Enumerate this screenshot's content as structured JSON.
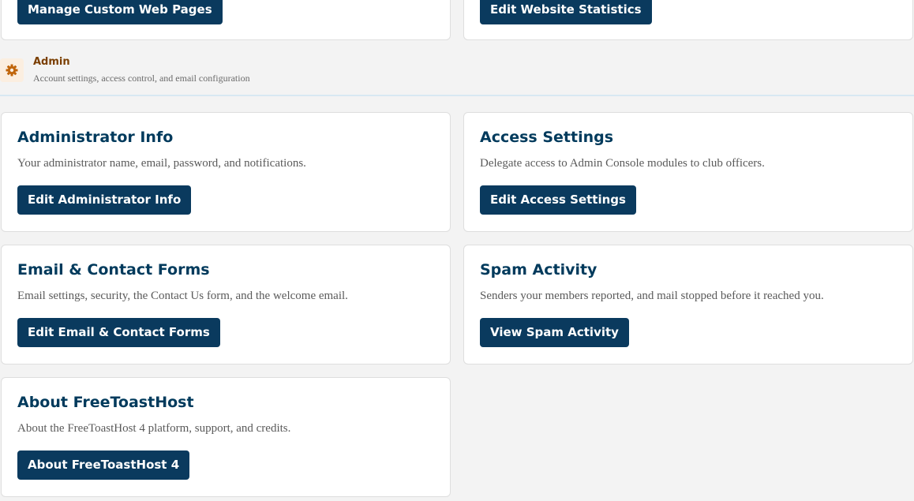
{
  "top_cards": [
    {
      "button": "Manage Custom Web Pages"
    },
    {
      "button": "Edit Website Statistics"
    }
  ],
  "section": {
    "icon": "gear-icon",
    "title": "Admin",
    "subtitle": "Account settings, access control, and email configuration"
  },
  "cards": [
    {
      "title": "Administrator Info",
      "description": "Your administrator name, email, password, and notifications.",
      "button": "Edit Administrator Info"
    },
    {
      "title": "Access Settings",
      "description": "Delegate access to Admin Console modules to club officers.",
      "button": "Edit Access Settings"
    },
    {
      "title": "Email & Contact Forms",
      "description": "Email settings, security, the Contact Us form, and the welcome email.",
      "button": "Edit Email & Contact Forms"
    },
    {
      "title": "Spam Activity",
      "description": "Senders your members reported, and mail stopped before it reached you.",
      "button": "View Spam Activity"
    },
    {
      "title": "About FreeToastHost",
      "description": "About the FreeToastHost 4 platform, support, and credits.",
      "button": "About FreeToastHost 4"
    }
  ],
  "colors": {
    "button": "#0a3a5e",
    "title": "#003a5c",
    "section_title": "#7a3e00",
    "icon": "#c0650b"
  }
}
